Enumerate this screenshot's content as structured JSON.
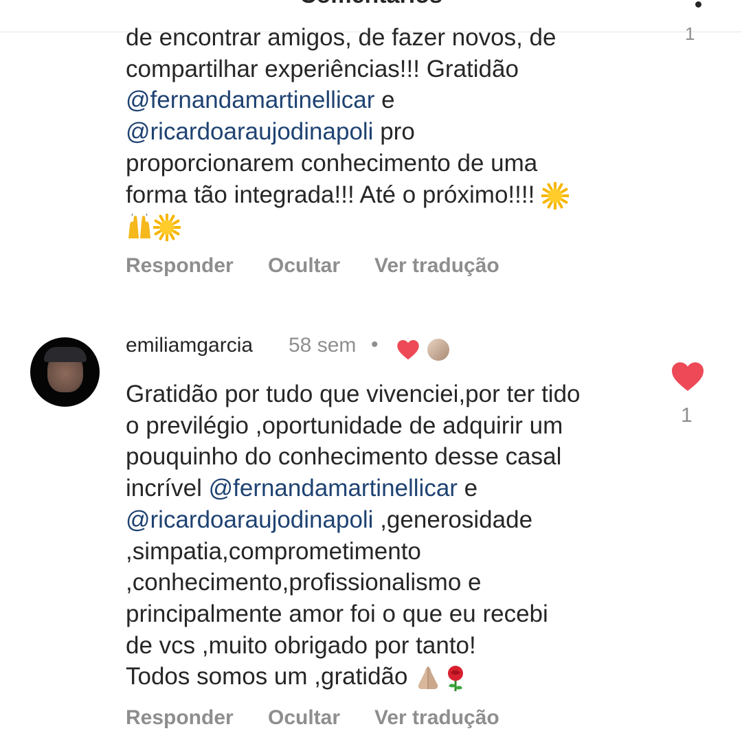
{
  "header": {
    "title": "Comentários"
  },
  "comment1": {
    "like_count": "1",
    "lines": [
      [
        {
          "t": "de encontrar amigos, de fazer novos, de"
        }
      ],
      [
        {
          "t": "compartilhar experiências!!! Gratidão"
        }
      ],
      [
        {
          "t": "@fernandamartinellicar",
          "m": true
        },
        {
          "t": " e"
        }
      ],
      [
        {
          "t": "@ricardoaraujodinapoli",
          "m": true
        },
        {
          "t": " pro"
        }
      ],
      [
        {
          "t": "proporcionarem conhecimento de uma"
        }
      ],
      [
        {
          "t": "forma tão integrada!!! Até o próximo!!!! "
        },
        {
          "e": "sun-emoji"
        }
      ],
      [
        {
          "e": "raising-hands-emoji"
        },
        {
          "e": "sun-emoji"
        }
      ]
    ],
    "actions": {
      "reply": "Responder",
      "hide": "Ocultar",
      "translate": "Ver tradução"
    }
  },
  "comment2": {
    "username": "emiliamgarcia",
    "time": "58 sem",
    "separator": "•",
    "like_count": "1",
    "lines": [
      [
        {
          "t": "Gratidão por tudo que vivenciei,por ter tido"
        }
      ],
      [
        {
          "t": "o previlégio ,oportunidade de adquirir um"
        }
      ],
      [
        {
          "t": "pouquinho do conhecimento desse casal"
        }
      ],
      [
        {
          "t": "incrível "
        },
        {
          "t": "@fernandamartinellicar",
          "m": true
        },
        {
          "t": " e"
        }
      ],
      [
        {
          "t": "@ricardoaraujodinapoli",
          "m": true
        },
        {
          "t": " ,generosidade"
        }
      ],
      [
        {
          "t": ",simpatia,comprometimento"
        }
      ],
      [
        {
          "t": ",conhecimento,profissionalismo e"
        }
      ],
      [
        {
          "t": "principalmente amor foi o que eu recebi"
        }
      ],
      [
        {
          "t": "de vcs ,muito obrigado por tanto!"
        }
      ],
      [
        {
          "t": "Todos somos um ,gratidão "
        },
        {
          "e": "folded-hands-emoji"
        },
        {
          "e": "rose-emoji"
        }
      ]
    ],
    "actions": {
      "reply": "Responder",
      "hide": "Ocultar",
      "translate": "Ver tradução"
    }
  },
  "colors": {
    "mention": "#1e4272",
    "heart": "#ed4956",
    "muted": "#8e8e8e"
  }
}
